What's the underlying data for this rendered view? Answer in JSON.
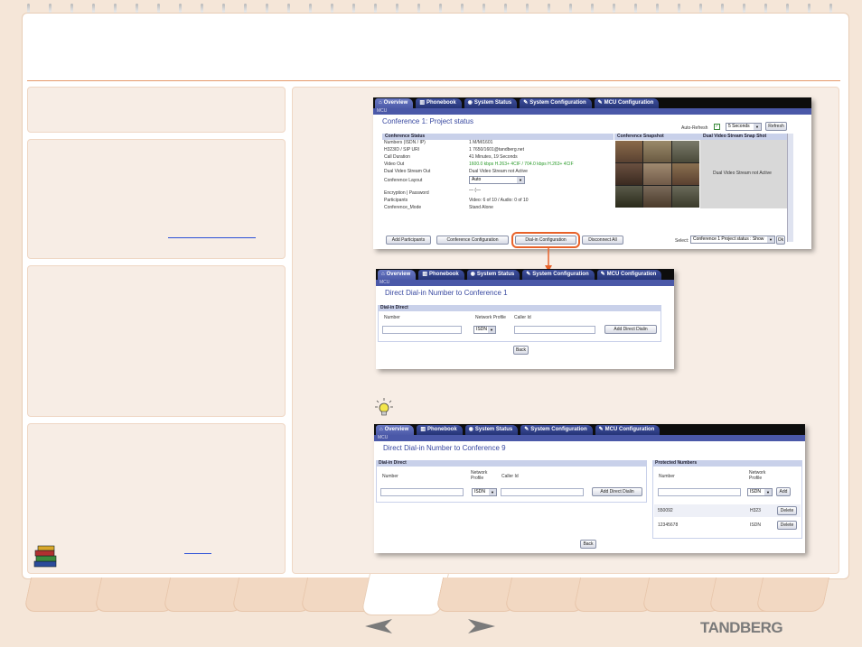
{
  "brand": "TANDBERG",
  "tabs": {
    "overview": "Overview",
    "phonebook": "Phonebook",
    "system_status": "System Status",
    "system_configuration": "System Configuration",
    "mcu_configuration": "MCU Configuration"
  },
  "mcu_label": "MCU",
  "shot1": {
    "title": "Conference 1: Project status",
    "auto_refresh_label": "Auto-Refresh",
    "refresh_interval": "5 Seconds",
    "refresh_button": "Refresh",
    "status_header": "Conference Status",
    "snapshot_header": "Conference Snapshot",
    "dual_header": "Dual Video Stream Snap Shot",
    "dual_text": "Dual Video Stream not Active",
    "rows": [
      {
        "label": "Numbers (ISDN / IP)",
        "value": "1 M/M/1601"
      },
      {
        "label": "H323ID / SIP URI",
        "value": "1 7650/1601@tandberg.net"
      },
      {
        "label": "Call Duration",
        "value": "41 Minutes, 19 Seconds"
      },
      {
        "label": "Video Out",
        "value": "1600.0 kbps H.263+ 4CIF / 704.0 kbps H.263+ 4CIF"
      },
      {
        "label": "Dual Video Stream Out",
        "value": "Dual Video Stream not Active"
      },
      {
        "label": "Conference Layout",
        "value": "Auto"
      },
      {
        "label": "Encryption | Password",
        "value": ""
      },
      {
        "label": "Participants",
        "value": "Video: 6 of 10  / Audio: 0 of 10"
      },
      {
        "label": "Conference_Mode",
        "value": "Stand Alone"
      }
    ],
    "buttons": [
      "Add Participants",
      "Conference Configuration",
      "Dial-in Configuration",
      "Disconnect All"
    ],
    "select_label": "Select:",
    "select_value": "Conference 1 Project status : Show",
    "ok_button": "Ok"
  },
  "shot2": {
    "title": "Direct Dial-in Number to Conference 1",
    "section": "Dial-in Direct",
    "col_number": "Number",
    "col_profile": "Network Profile",
    "col_caller": "Caller Id",
    "profile_value": "ISDN",
    "add_button": "Add Direct Dialin",
    "back_button": "Back"
  },
  "shot3": {
    "title": "Direct Dial-in Number to Conference 9",
    "section": "Dial-in Direct",
    "col_number": "Number",
    "col_profile": "Network Profile",
    "col_caller": "Caller Id",
    "profile_value": "ISDN",
    "add_button": "Add Direct Dialin",
    "back_button": "Back",
    "protected_header": "Protected Numbers",
    "protected_col_number": "Number",
    "protected_col_profile": "Network Profile",
    "protected_profile_value": "ISDN",
    "protected_add": "Add",
    "protected_rows": [
      {
        "number": "550092",
        "profile": "H323",
        "action": "Delete"
      },
      {
        "number": "12345678",
        "profile": "ISDN",
        "action": "Delete"
      }
    ]
  },
  "colors": {
    "accent": "#e8622a",
    "tab_blue": "#3e4f9e",
    "page_bg": "#f5e6d8"
  }
}
